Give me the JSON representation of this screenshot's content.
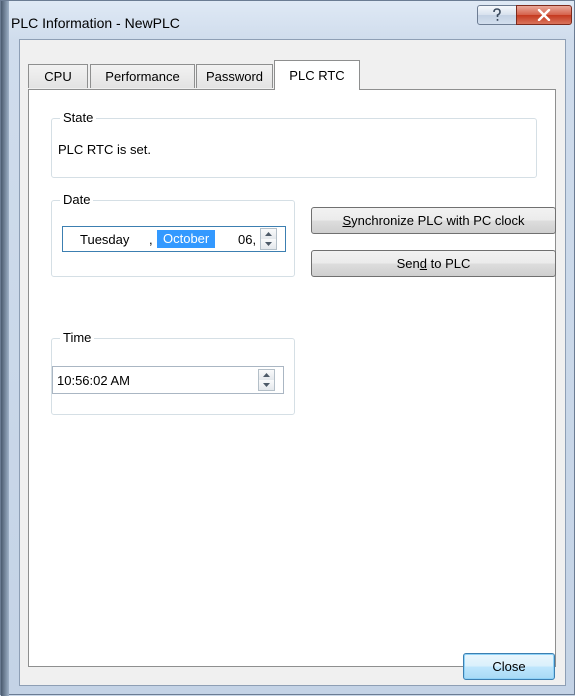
{
  "window": {
    "title": "PLC Information - NewPLC",
    "help_icon": "question-mark-icon",
    "close_icon": "close-x-icon"
  },
  "tabs": [
    {
      "label": "CPU",
      "active": false
    },
    {
      "label": "Performance",
      "active": false
    },
    {
      "label": "Password",
      "active": false
    },
    {
      "label": "PLC RTC",
      "active": true
    }
  ],
  "state": {
    "group_label": "State",
    "text": "PLC RTC is set."
  },
  "date": {
    "group_label": "Date",
    "weekday": "Tuesday",
    "sep": ",",
    "month": "October",
    "day": "06,"
  },
  "time": {
    "group_label": "Time",
    "value": "10:56:02 AM"
  },
  "buttons": {
    "sync_pre": "",
    "sync_mnemonic": "S",
    "sync_post": "ynchronize PLC with PC clock",
    "send_pre": "Sen",
    "send_mnemonic": "d",
    "send_post": " to PLC",
    "close": "Close"
  },
  "colors": {
    "selection": "#3399ff",
    "close_button": "#c5391f"
  }
}
